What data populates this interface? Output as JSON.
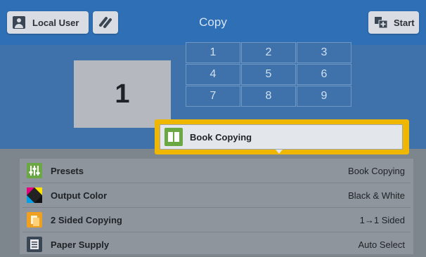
{
  "header": {
    "user_label": "Local User",
    "title": "Copy",
    "start_label": "Start"
  },
  "quantity": "1",
  "keypad": {
    "keys": [
      "1",
      "2",
      "3",
      "4",
      "5",
      "6",
      "7",
      "8",
      "9"
    ]
  },
  "popup": {
    "label": "Book Copying",
    "icon": "book-icon"
  },
  "features": [
    {
      "label": "Presets",
      "value": "Book Copying",
      "icon": "presets-icon"
    },
    {
      "label": "Output Color",
      "value": "Black & White",
      "icon": "color-icon"
    },
    {
      "label": "2 Sided Copying",
      "value": "1→1 Sided",
      "icon": "duplex-icon"
    },
    {
      "label": "Paper Supply",
      "value": "Auto Select",
      "icon": "paper-icon"
    }
  ],
  "colors": {
    "header_blue": "#2f6fb5",
    "highlight": "#f0b700"
  }
}
